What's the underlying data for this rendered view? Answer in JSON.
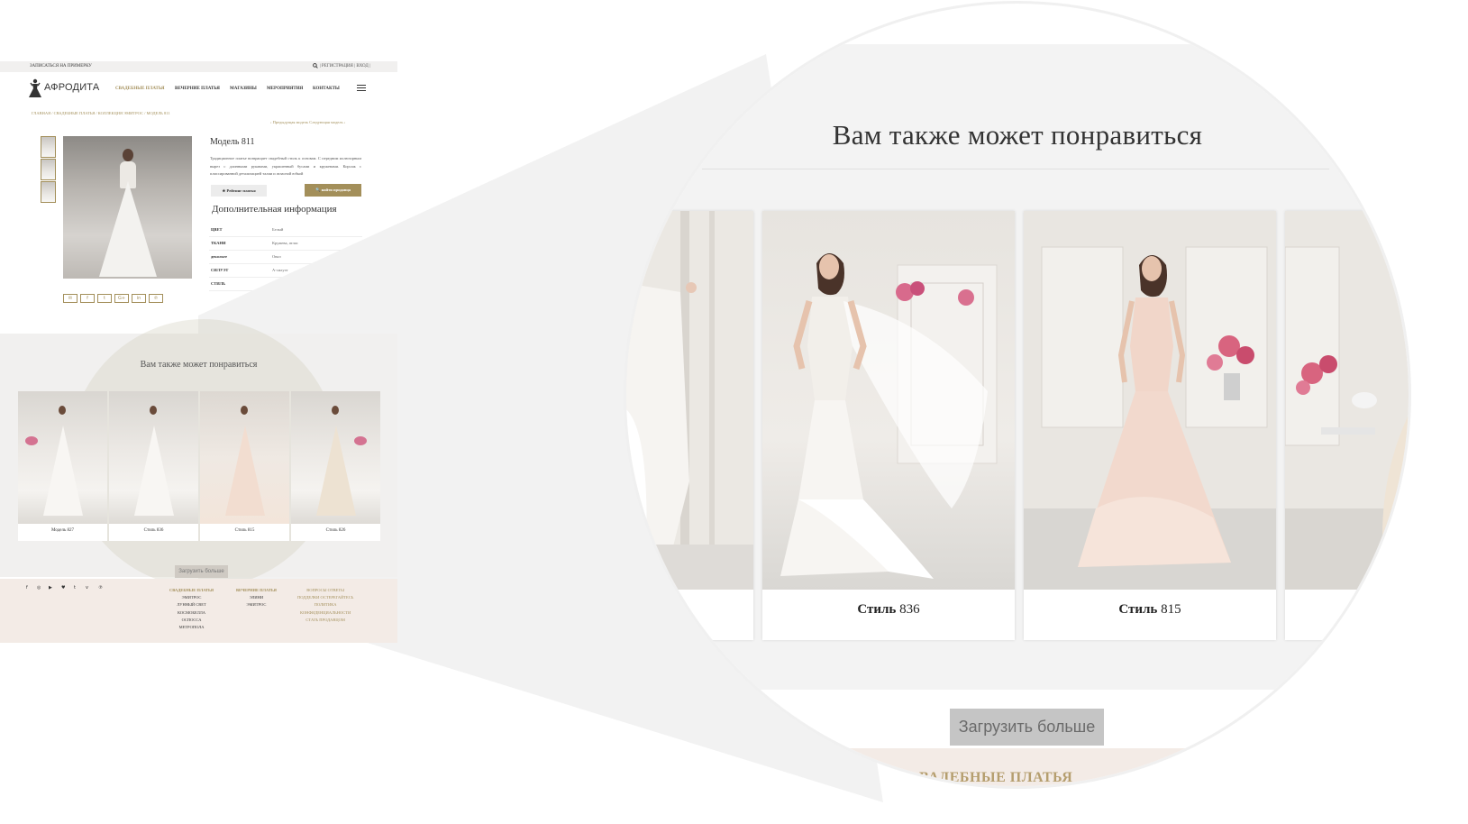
{
  "topbar": {
    "signup_fitting": "ЗАПИСАТЬСЯ НА ПРИМЕРКУ",
    "auth_links": "| РЕГИСТРАЦИЯ | ВХОД |"
  },
  "brand": {
    "name": "АФРОДИТА"
  },
  "nav": {
    "items": [
      "СВАДЕБНЫЕ ПЛАТЬЯ",
      "ВЕЧЕРНИЕ ПЛАТЬЯ",
      "МАГАЗИНЫ",
      "МЕРОПРИЯТИЯ",
      "КОНТАКТЫ"
    ],
    "active": "СВАДЕБНЫЕ ПЛАТЬЯ"
  },
  "breadcrumb": "ГЛАВНАЯ / СВАДЕБНЫЕ ПЛАТЬЯ / КОЛЛЕКЦИЯ ЭМИТРОС / МОДЕЛЬ 811",
  "pager": "‹ Предыдущая модель   Следующая модель ›",
  "product": {
    "title": "Модель 811",
    "description": "Традиционное платье возвращает свадебный стиль к основам. С передним иллюзорным вырез с длинными рукавами, украшенный бусами и кружевами. Корсаж с плиссированной детализацией талии и атласной юбкой",
    "rate_button": "★ Рейтинг платья",
    "find_button": "🔍 найти продавца",
    "additional_info_heading": "Дополнительная информация",
    "attributes": [
      {
        "key": "ЦВЕТ",
        "value": "Белый"
      },
      {
        "key": "ТКАНИ",
        "value": "Кружева, атлас"
      },
      {
        "key": "декольте",
        "value": "Овал"
      },
      {
        "key": "СИЛУЭТ",
        "value": "А-силуэт"
      },
      {
        "key": "СТИЛЬ",
        "value": "Классический"
      }
    ]
  },
  "share_icons": [
    "envelope-icon",
    "facebook-icon",
    "twitter-icon",
    "google-plus-icon",
    "linkedin-icon",
    "pinterest-icon"
  ],
  "recommendations": {
    "heading": "Вам также может понравиться",
    "cards": [
      {
        "caption": "Модель 827"
      },
      {
        "caption": "Стиль 836"
      },
      {
        "caption": "Стиль 815"
      },
      {
        "caption": "Стиль 826"
      }
    ],
    "load_more": "Загрузить больше"
  },
  "footer": {
    "social_icons": [
      "facebook-icon",
      "instagram-icon",
      "youtube-icon",
      "twitter-icon",
      "tumblr-icon",
      "vimeo-icon",
      "pinterest-icon"
    ],
    "col1": {
      "heading": "СВАДЕБНЫЕ ПЛАТЬЯ",
      "items": [
        "ЭМИТРОС",
        "ЛУННЫЙ СВЕТ",
        "КОСМОБЕЛЛА",
        "ОСПОССА",
        "МЕТРОПОЛА"
      ]
    },
    "col2": {
      "heading": "ВЕЧЕРНИЕ ПЛАТЬЯ",
      "items": [
        "ЭЛИНИ",
        "ЭМИТРОС"
      ]
    },
    "col3": {
      "items": [
        "ВОПРОСЫ ОТВЕТЫ",
        "ПОДДЕЛКИ ОСТЕРЕГАЙТЕСЬ",
        "ПОЛИТИКА",
        "КОНФИДЕНЦИАЛЬНОСТИ",
        "СТАТЬ ПРОДАВЦОМ"
      ]
    }
  },
  "zoom": {
    "heading": "Вам также может понравиться",
    "cards": [
      {
        "caption_word": "Стиль",
        "caption_num": "836"
      },
      {
        "caption_word": "Стиль",
        "caption_num": "815"
      }
    ],
    "load_more": "Загрузить больше",
    "footer_partial": "ВАДЕБНЫЕ ПЛАТЬЯ"
  },
  "colors": {
    "accent": "#a38f5a",
    "footer_bg": "#f3ebe6",
    "section_bg": "#f1f0ef"
  }
}
